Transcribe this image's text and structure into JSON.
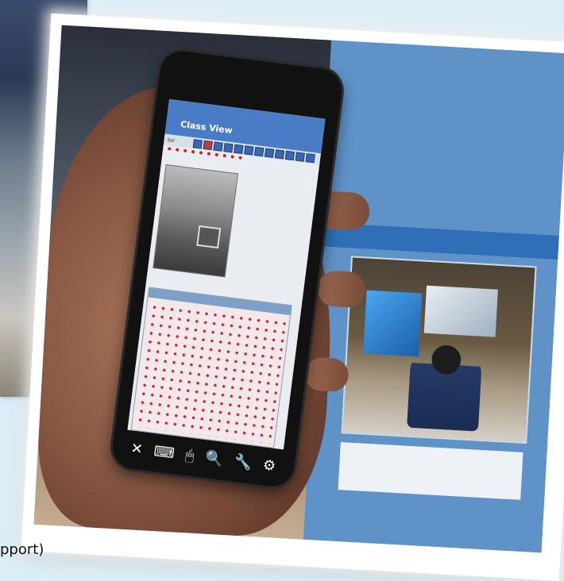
{
  "caption": {
    "text": "pport)"
  },
  "phone_app": {
    "title": "Class View",
    "toolbar_label": "Sel",
    "toolbar_icons": [
      "close-icon",
      "keyboard-icon",
      "mouse-icon",
      "search-icon",
      "wrench-icon",
      "gear-icon"
    ]
  },
  "toolbar_glyphs": {
    "close": "✕",
    "keyboard": "⌨",
    "mouse": "🖱",
    "search": "🔍",
    "wrench": "🔧",
    "gear": "⚙"
  }
}
